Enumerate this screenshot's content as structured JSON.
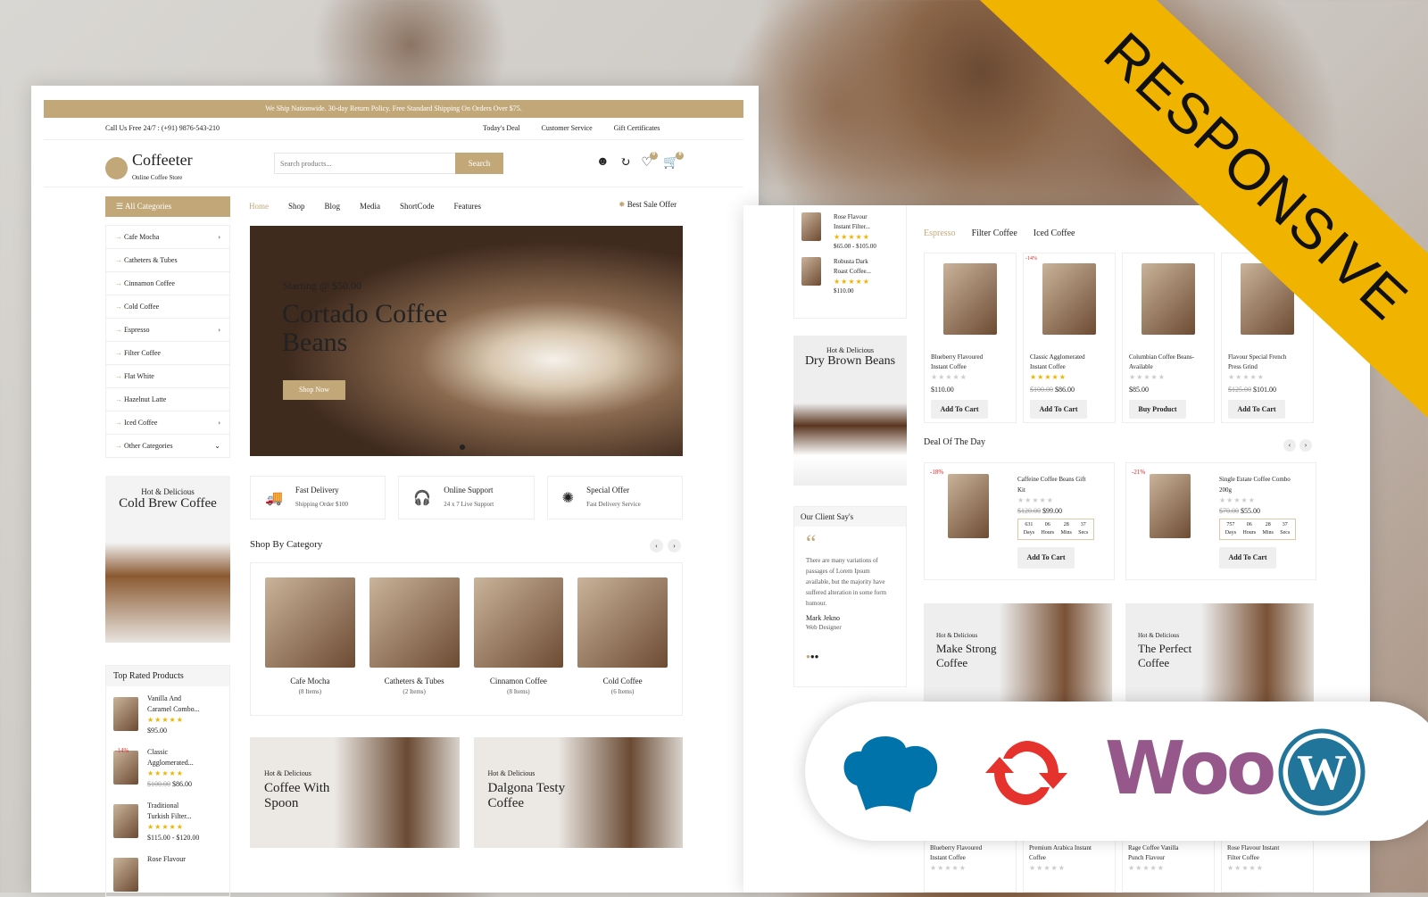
{
  "topbar": {
    "notice": "We Ship Nationwide. 30-day Return Policy. Free Standard Shipping On Orders Over $75.",
    "phone": "Call Us Free 24/7 : (+91) 9876-543-210",
    "links": [
      "Today's Deal",
      "Customer Service",
      "Gift Certificates"
    ]
  },
  "header": {
    "logo": "Coffeeter",
    "tagline": "Online Coffee Store",
    "search_placeholder": "Search products...",
    "search_label": "Search",
    "wishlist_count": "0",
    "cart_count": "0"
  },
  "nav": {
    "all_categories": "All Categories",
    "items": [
      "Home",
      "Shop",
      "Blog",
      "Media",
      "ShortCode",
      "Features"
    ],
    "best_sale": "Best Sale Offer"
  },
  "categories": [
    "Cafe Mocha",
    "Catheters & Tubes",
    "Cinnamon Coffee",
    "Cold Coffee",
    "Espresso",
    "Filter Coffee",
    "Flat White",
    "Hazelnut Latte",
    "Iced Coffee",
    "Other Categories"
  ],
  "hero": {
    "sub": "Starting @ $50.00",
    "title1": "Cortado Coffee",
    "title2": "Beans",
    "button": "Shop Now"
  },
  "features": [
    {
      "title": "Fast Delivery",
      "sub": "Shipping Order $100"
    },
    {
      "title": "Online Support",
      "sub": "24 x 7 Live Support"
    },
    {
      "title": "Special Offer",
      "sub": "Fast Delivery Service"
    }
  ],
  "side_banner": {
    "sub": "Hot & Delicious",
    "title": "Cold Brew Coffee"
  },
  "shop_by_category": {
    "title": "Shop By Category",
    "items": [
      {
        "name": "Cafe Mocha",
        "count": "(8 Items)"
      },
      {
        "name": "Catheters & Tubes",
        "count": "(2 Items)"
      },
      {
        "name": "Cinnamon Coffee",
        "count": "(8 Items)"
      },
      {
        "name": "Cold Coffee",
        "count": "(6 Items)"
      }
    ]
  },
  "top_rated": {
    "title": "Top Rated Products",
    "items": [
      {
        "name1": "Vanilla And",
        "name2": "Caramel Combo...",
        "old": "",
        "price": "$95.00",
        "badge": ""
      },
      {
        "name1": "Classic",
        "name2": "Agglomerated...",
        "old": "$100.00",
        "price": "$86.00",
        "badge": "-14%"
      },
      {
        "name1": "Traditional",
        "name2": "Turkish Filter...",
        "old": "",
        "price": "$115.00 - $120.00",
        "badge": ""
      },
      {
        "name1": "Rose Flavour",
        "name2": "",
        "old": "",
        "price": "",
        "badge": ""
      }
    ]
  },
  "promo": [
    {
      "sub": "Hot & Delicious",
      "title1": "Coffee With",
      "title2": "Spoon"
    },
    {
      "sub": "Hot & Delicious",
      "title1": "Dalgona Testy",
      "title2": "Coffee"
    }
  ],
  "right": {
    "mini_products": [
      {
        "name1": "Rose Flavour",
        "name2": "Instant Filter...",
        "price": "$65.00 - $105.00"
      },
      {
        "name1": "Robusta Dark",
        "name2": "Roast Coffee...",
        "price": "$110.00"
      }
    ],
    "dry_banner": {
      "sub": "Hot & Delicious",
      "title": "Dry Brown Beans"
    },
    "tabs": [
      "Espresso",
      "Filter Coffee",
      "Iced Coffee"
    ],
    "products": [
      {
        "name1": "Blueberry Flavoured",
        "name2": "Instant Coffee",
        "old": "",
        "price": "$110.00",
        "button": "Add To Cart",
        "badge": "",
        "rated": false
      },
      {
        "name1": "Classic Agglomerated",
        "name2": "Instant Coffee",
        "old": "$100.00",
        "price": "$86.00",
        "button": "Add To Cart",
        "badge": "-14%",
        "rated": true
      },
      {
        "name1": "Columbian Coffee Beans-",
        "name2": "Available",
        "old": "",
        "price": "$85.00",
        "button": "Buy Product",
        "badge": "",
        "rated": false
      },
      {
        "name1": "Flavour Special French",
        "name2": "Press Grind",
        "old": "$125.00",
        "price": "$101.00",
        "button": "Add To Cart",
        "badge": "",
        "rated": false
      }
    ],
    "deal": {
      "title": "Deal Of The Day",
      "items": [
        {
          "name1": "Caffeine Coffee Beans Gift",
          "name2": "Kit",
          "old": "$120.00",
          "price": "$99.00",
          "badge": "-18%",
          "days": "631",
          "hours": "06",
          "mins": "28",
          "secs": "37",
          "button": "Add To Cart"
        },
        {
          "name1": "Single Estate Coffee Combo",
          "name2": "200g",
          "old": "$70.00",
          "price": "$55.00",
          "badge": "-21%",
          "days": "757",
          "hours": "06",
          "mins": "28",
          "secs": "37",
          "button": "Add To Cart"
        }
      ],
      "labels": [
        "Days",
        "Hours",
        "Mins",
        "Secs"
      ]
    },
    "testimonial": {
      "title": "Our Client Say's",
      "text": "There are many variations of passages of Lorem Ipsum available, but the majority have suffered alteration in some form humour.",
      "name": "Mark Jekno",
      "role": "Web Designer"
    },
    "banners": [
      {
        "sub": "Hot & Delicious",
        "title1": "Make Strong",
        "title2": "Coffee"
      },
      {
        "sub": "Hot & Delicious",
        "title1": "The Perfect",
        "title2": "Coffee"
      }
    ],
    "bottom_products": [
      {
        "name1": "Blueberry Flavoured",
        "name2": "Instant Coffee"
      },
      {
        "name1": "Premium Arabica Instant",
        "name2": "Coffee"
      },
      {
        "name1": "Rage Coffee Vanilla",
        "name2": "Punch Flavour"
      },
      {
        "name1": "Rose Flavour Instant",
        "name2": "Filter Coffee"
      }
    ]
  },
  "ribbon": {
    "text": "RESPONSIVE",
    "color": "#f0b400"
  },
  "logos": [
    "chef-hat-icon",
    "sync-icon",
    "woo-logo",
    "wordpress-logo"
  ],
  "colors": {
    "accent": "#c2a878",
    "sale": "#e02020",
    "woo": "#96588a",
    "wordpress": "#21759b"
  }
}
